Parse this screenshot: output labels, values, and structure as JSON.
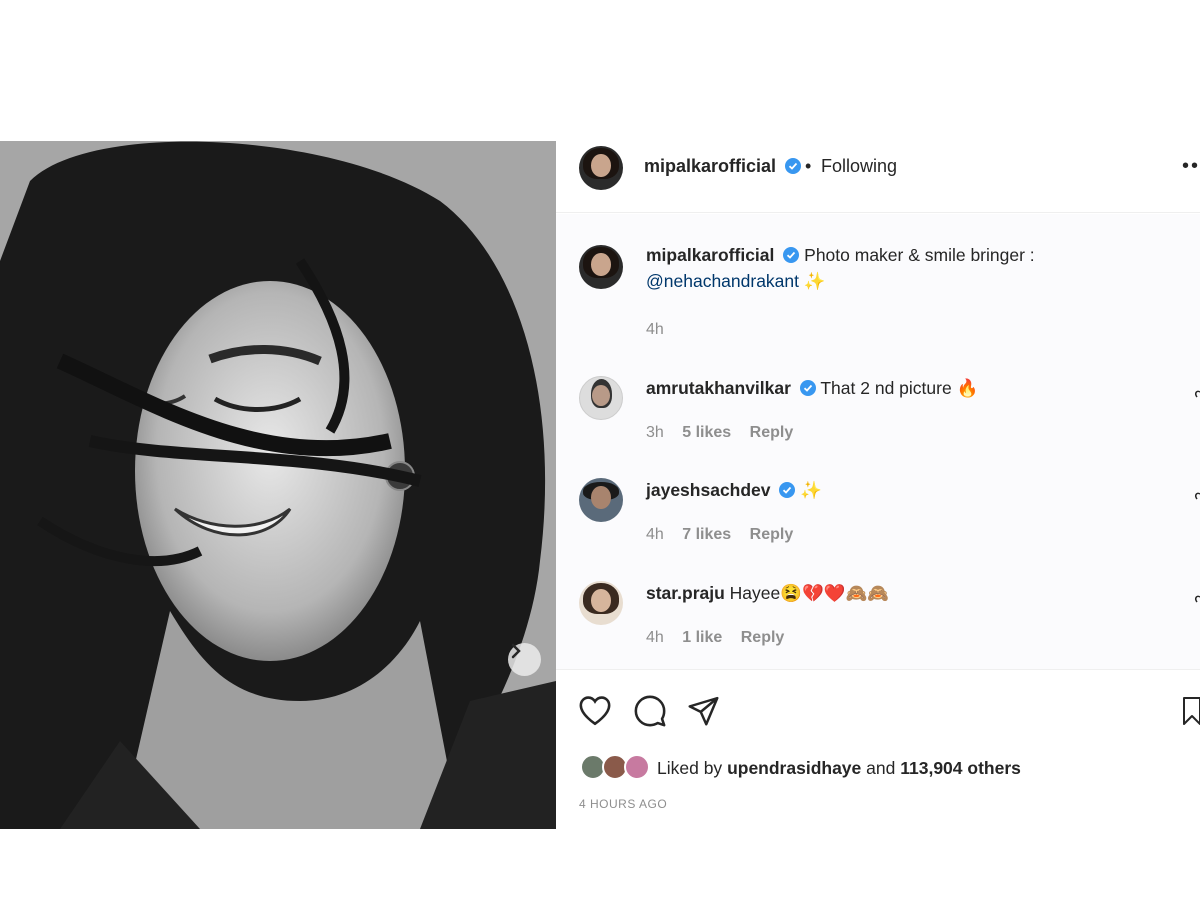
{
  "post": {
    "username": "mipalkarofficial",
    "separator": "•",
    "follow_status": "Following",
    "more_icon": "more-options-icon",
    "caption_text": "Photo maker & smile bringer :",
    "caption_mention": "@nehachandrakant",
    "caption_emoji": "✨",
    "caption_time": "4h"
  },
  "comments": [
    {
      "username": "amrutakhanvilkar",
      "verified": true,
      "text": "That 2 nd picture 🔥",
      "time": "3h",
      "likes": "5 likes",
      "reply": "Reply"
    },
    {
      "username": "jayeshsachdev",
      "verified": true,
      "text": "✨",
      "time": "4h",
      "likes": "7 likes",
      "reply": "Reply"
    },
    {
      "username": "star.praju",
      "verified": false,
      "text": "Hayee😫💔❤️🙈🙈",
      "time": "4h",
      "likes": "1 like",
      "reply": "Reply"
    }
  ],
  "actions": {
    "like_icon": "heart-icon",
    "comment_icon": "comment-icon",
    "share_icon": "send-icon",
    "save_icon": "bookmark-icon"
  },
  "likes_summary": {
    "prefix": "Liked by",
    "user": "upendrasidhaye",
    "conjunction": "and",
    "count": "113,904 others"
  },
  "timestamp": "4 HOURS AGO",
  "colors": {
    "verified_blue": "#3897f0",
    "mention_blue": "#00376b",
    "muted_text": "#8e8e8e"
  }
}
